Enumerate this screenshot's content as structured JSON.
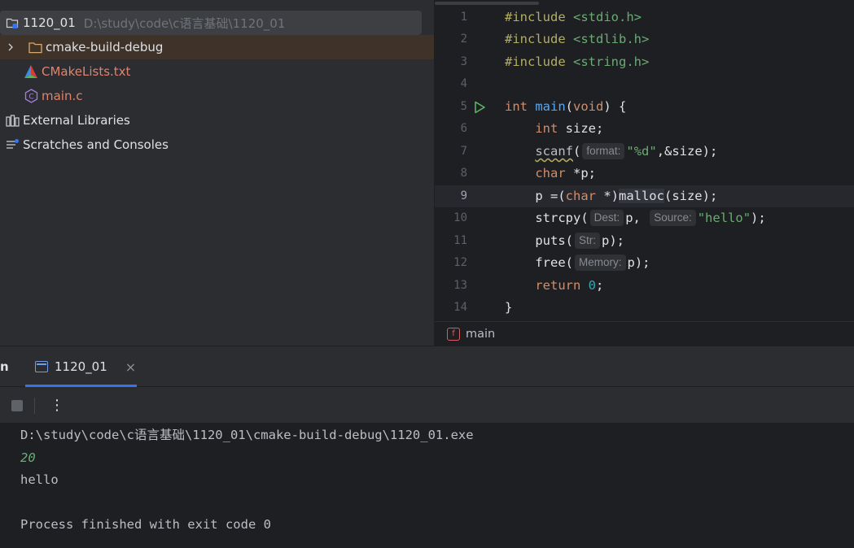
{
  "project": {
    "root_name": "1120_01",
    "root_path": "D:\\study\\code\\c语言基础\\1120_01",
    "items": [
      {
        "label": "cmake-build-debug",
        "icon": "folder-icon"
      },
      {
        "label": "CMakeLists.txt",
        "icon": "cmake-icon"
      },
      {
        "label": "main.c",
        "icon": "c-file-icon"
      },
      {
        "label": "External Libraries",
        "icon": "libraries-icon"
      },
      {
        "label": "Scratches and Consoles",
        "icon": "scratches-icon"
      }
    ]
  },
  "editor": {
    "line_numbers": [
      "1",
      "2",
      "3",
      "4",
      "5",
      "6",
      "7",
      "8",
      "9",
      "10",
      "11",
      "12",
      "13",
      "14"
    ],
    "current_line": 9,
    "code": {
      "l1_kw": "#include",
      "l1_hdr": "<stdio.h>",
      "l2_kw": "#include",
      "l2_hdr": "<stdlib.h>",
      "l3_kw": "#include",
      "l3_hdr": "<string.h>",
      "l5_type": "int",
      "l5_name": "main",
      "l5_open": "(",
      "l5_void": "void",
      "l5_rest": ") {",
      "l6_indent": "    ",
      "l6_type": "int",
      "l6_rest": " size;",
      "l7_indent": "    ",
      "l7_fn": "scanf",
      "l7_open": "(",
      "l7_hint": "format:",
      "l7_str": "\"%d\"",
      "l7_rest": ",&size);",
      "l8_indent": "    ",
      "l8_type": "char",
      "l8_rest": " *p;",
      "l9_indent": "    ",
      "l9_a": "p =(",
      "l9_type": "char",
      "l9_b": " *)",
      "l9_fn": "malloc",
      "l9_c": "(size);",
      "l10_indent": "    ",
      "l10_fn": "strcpy",
      "l10_open": "(",
      "l10_hint1": "Dest:",
      "l10_arg1": "p, ",
      "l10_hint2": "Source:",
      "l10_str": "\"hello\"",
      "l10_rest": ");",
      "l11_indent": "    ",
      "l11_fn": "puts",
      "l11_open": "(",
      "l11_hint": "Str:",
      "l11_rest": "p);",
      "l12_indent": "    ",
      "l12_fn": "free",
      "l12_open": "(",
      "l12_hint": "Memory:",
      "l12_rest": "p);",
      "l13_indent": "    ",
      "l13_kw": "return",
      "l13_sp": " ",
      "l13_num": "0",
      "l13_rest": ";",
      "l14": "}"
    },
    "breadcrumb": "main"
  },
  "run_panel": {
    "title_fragment": "n",
    "tab_label": "1120_01",
    "close_glyph": "×",
    "more_glyph": "⋮",
    "console": [
      "D:\\study\\code\\c语言基础\\1120_01\\cmake-build-debug\\1120_01.exe",
      "20",
      "hello",
      "",
      "Process finished with exit code 0"
    ]
  },
  "colors": {
    "accent": "#3574f0",
    "keyword": "#cf8e6d",
    "function": "#56a8f5",
    "string": "#6aab73",
    "number": "#2aacb8",
    "preprocessor": "#b3ae60"
  }
}
